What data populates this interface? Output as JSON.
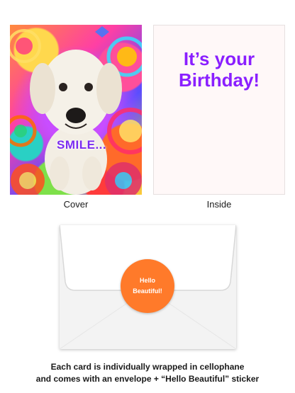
{
  "cover": {
    "label": "Cover",
    "caption": "SMILE..."
  },
  "inside": {
    "label": "Inside",
    "message_line1": "It’s your",
    "message_line2": "Birthday!"
  },
  "envelope": {
    "sticker_line1": "Hello",
    "sticker_line2": "Beautiful!"
  },
  "description": {
    "line1": "Each card is individually wrapped in cellophane",
    "line2": "and comes with an envelope + “Hello Beautiful” sticker"
  },
  "colors": {
    "inside_text": "#8a1fff",
    "caption_text": "#7b2cf0",
    "sticker": "#ff7a2a"
  }
}
